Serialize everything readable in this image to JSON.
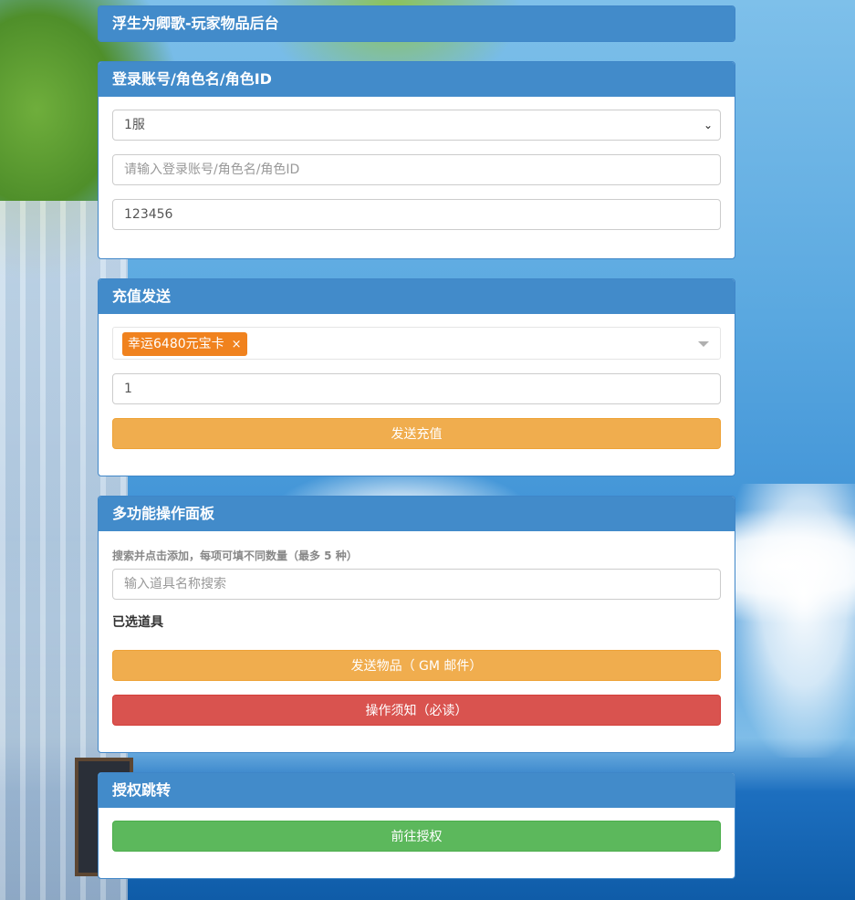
{
  "header": {
    "title": "浮生为卿歌-玩家物品后台"
  },
  "login": {
    "title": "登录账号/角色名/角色ID",
    "server_value": "1服",
    "account_placeholder": "请输入登录账号/角色名/角色ID",
    "password_value": "123456"
  },
  "recharge": {
    "title": "充值发送",
    "selected_tag": "幸运6480元宝卡",
    "tag_remove": "×",
    "quantity_value": "1",
    "send_button": "发送充值"
  },
  "multi": {
    "title": "多功能操作面板",
    "hint": "搜索并点击添加，每项可填不同数量（最多 5 种）",
    "search_placeholder": "输入道具名称搜索",
    "selected_label": "已选道具",
    "send_items_button": "发送物品（ GM 邮件）",
    "notice_button": "操作须知（必读）"
  },
  "auth": {
    "title": "授权跳转",
    "go_button": "前往授权"
  }
}
